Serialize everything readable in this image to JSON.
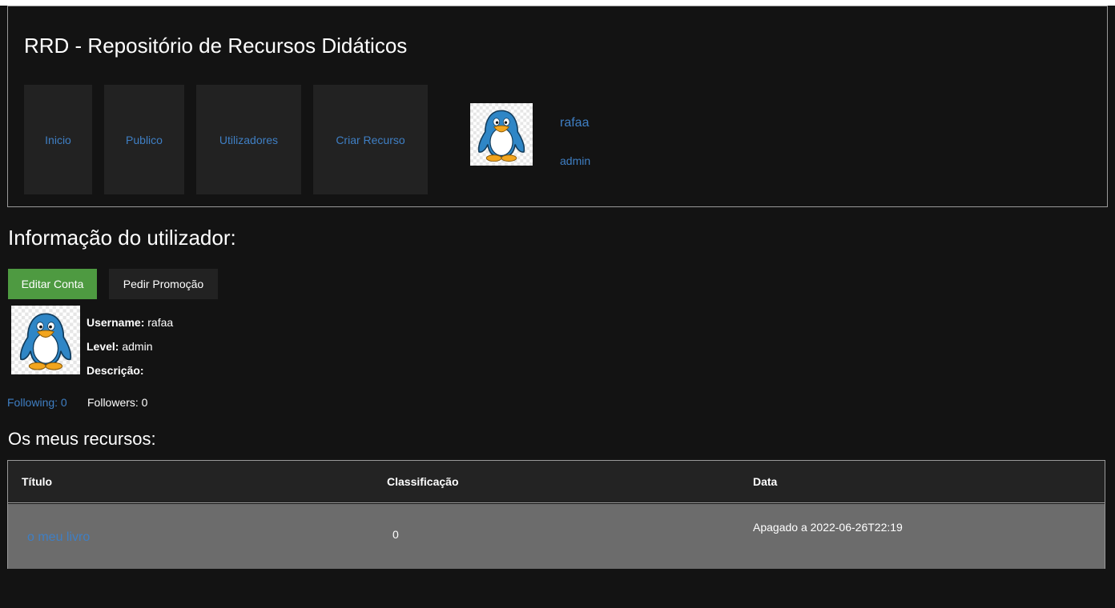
{
  "header": {
    "title": "RRD - Repositório de Recursos Didáticos",
    "nav": [
      {
        "label": "Inicio"
      },
      {
        "label": "Publico"
      },
      {
        "label": "Utilizadores"
      },
      {
        "label": "Criar Recurso"
      }
    ],
    "user": {
      "username": "rafaa",
      "level": "admin",
      "avatar_icon": "penguin-avatar-icon"
    }
  },
  "profile": {
    "title": "Informação do utilizador:",
    "buttons": {
      "edit": "Editar Conta",
      "promo": "Pedir Promoção"
    },
    "avatar_icon": "penguin-avatar-icon",
    "username_label": "Username:",
    "username_value": "rafaa",
    "level_label": "Level:",
    "level_value": "admin",
    "description_label": "Descrição:",
    "description_value": "",
    "following": "Following: 0",
    "followers": "Followers: 0"
  },
  "resources": {
    "title": "Os meus recursos:",
    "columns": [
      "Título",
      "Classificação",
      "Data"
    ],
    "rows": [
      {
        "titulo": "o meu livro",
        "classificacao": "0",
        "data": "Apagado a 2022-06-26T22:19"
      }
    ]
  },
  "colors": {
    "background": "#131313",
    "link": "#3f7fc4",
    "edit_button": "#4e9a41",
    "panel": "#222222",
    "row": "#6c6c6c"
  }
}
